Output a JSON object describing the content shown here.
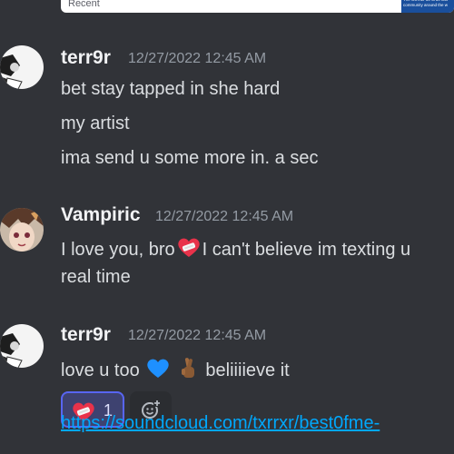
{
  "embed": {
    "label": "Recent",
    "thumb_text": "The COVID-19 virus has\ncommunity around the w"
  },
  "messages": [
    {
      "author": "terr9r",
      "timestamp": "12/27/2022 12:45 AM",
      "lines": [
        "bet stay tapped in she hard",
        "my artist",
        "ima send u some more in. a sec"
      ]
    },
    {
      "author": "Vampiric",
      "timestamp": "12/27/2022 12:45 AM",
      "line1_before": "I love you, bro",
      "line1_after": "I can't believe im texting u",
      "line2": "real time"
    },
    {
      "author": "terr9r",
      "timestamp": "12/27/2022 12:45 AM",
      "text_before": "love u too",
      "text_after": "beliiiieve it"
    }
  ],
  "reaction": {
    "emoji": "heart-with-bandage",
    "count": "1"
  },
  "link_text": "https://soundcloud.com/txrrxr/best0fme-",
  "icons": {
    "heart": "heart-with-bandage-icon",
    "blue_heart": "blue-heart-icon",
    "crossed_fingers": "crossed-fingers-icon",
    "add_reaction": "add-reaction-icon"
  },
  "colors": {
    "background": "#313338",
    "username": "#f2f3f5",
    "timestamp": "#949ba4",
    "text": "#dbdee1",
    "link": "#00a8fc",
    "reaction_border": "#5865f2"
  }
}
